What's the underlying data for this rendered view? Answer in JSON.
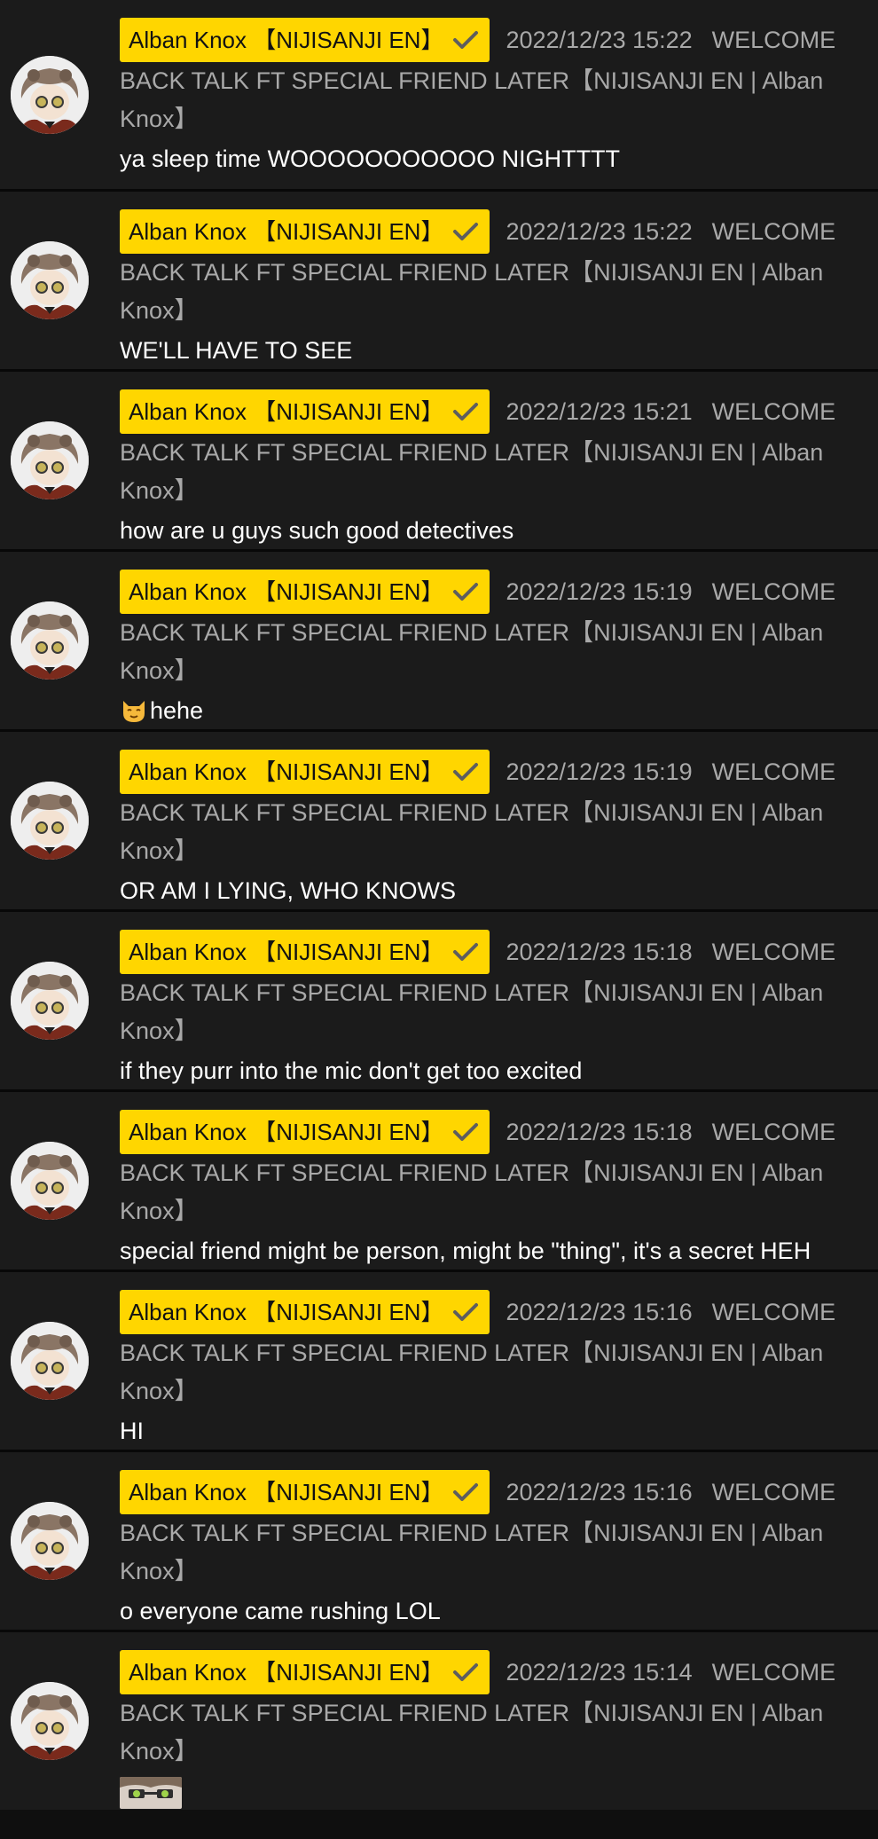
{
  "colors": {
    "badge_bg": "#ffd600",
    "row_bg": "#1b1b1b",
    "separator": "#080808",
    "meta_text": "#a9a9a9",
    "body_text": "#ffffff"
  },
  "messages": [
    {
      "author": "Alban Knox 【NIJISANJI EN】",
      "verified_icon": "checkmark-icon",
      "timestamp": "2022/12/23 15:22",
      "title_first": "WELCOME",
      "title_second": "BACK TALK FT SPECIAL FRIEND LATER【NIJISANJI EN | Alban",
      "title_third": "Knox】",
      "text": "ya sleep time WOOOOOOOOOOO NIGHTTTT"
    },
    {
      "author": "Alban Knox 【NIJISANJI EN】",
      "verified_icon": "checkmark-icon",
      "timestamp": "2022/12/23 15:22",
      "title_first": "WELCOME",
      "title_second": "BACK TALK FT SPECIAL FRIEND LATER【NIJISANJI EN | Alban",
      "title_third": "Knox】",
      "text": "WE'LL HAVE TO SEE"
    },
    {
      "author": "Alban Knox 【NIJISANJI EN】",
      "verified_icon": "checkmark-icon",
      "timestamp": "2022/12/23 15:21",
      "title_first": "WELCOME",
      "title_second": "BACK TALK FT SPECIAL FRIEND LATER【NIJISANJI EN | Alban",
      "title_third": "Knox】",
      "text": "how are u guys such good detectives"
    },
    {
      "author": "Alban Knox 【NIJISANJI EN】",
      "verified_icon": "checkmark-icon",
      "timestamp": "2022/12/23 15:19",
      "title_first": "WELCOME",
      "title_second": "BACK TALK FT SPECIAL FRIEND LATER【NIJISANJI EN | Alban",
      "title_third": "Knox】",
      "text": "hehe",
      "leading_emoji": "cat-face-emoji"
    },
    {
      "author": "Alban Knox 【NIJISANJI EN】",
      "verified_icon": "checkmark-icon",
      "timestamp": "2022/12/23 15:19",
      "title_first": "WELCOME",
      "title_second": "BACK TALK FT SPECIAL FRIEND LATER【NIJISANJI EN | Alban",
      "title_third": "Knox】",
      "text": "OR AM I LYING, WHO KNOWS"
    },
    {
      "author": "Alban Knox 【NIJISANJI EN】",
      "verified_icon": "checkmark-icon",
      "timestamp": "2022/12/23 15:18",
      "title_first": "WELCOME",
      "title_second": "BACK TALK FT SPECIAL FRIEND LATER【NIJISANJI EN | Alban",
      "title_third": "Knox】",
      "text": "if they purr into the mic don't get too excited"
    },
    {
      "author": "Alban Knox 【NIJISANJI EN】",
      "verified_icon": "checkmark-icon",
      "timestamp": "2022/12/23 15:18",
      "title_first": "WELCOME",
      "title_second": "BACK TALK FT SPECIAL FRIEND LATER【NIJISANJI EN | Alban",
      "title_third": "Knox】",
      "text": "special friend might be person, might be \"thing\", it's a secret HEH"
    },
    {
      "author": "Alban Knox 【NIJISANJI EN】",
      "verified_icon": "checkmark-icon",
      "timestamp": "2022/12/23 15:16",
      "title_first": "WELCOME",
      "title_second": "BACK TALK FT SPECIAL FRIEND LATER【NIJISANJI EN | Alban",
      "title_third": "Knox】",
      "text": "HI"
    },
    {
      "author": "Alban Knox 【NIJISANJI EN】",
      "verified_icon": "checkmark-icon",
      "timestamp": "2022/12/23 15:16",
      "title_first": "WELCOME",
      "title_second": "BACK TALK FT SPECIAL FRIEND LATER【NIJISANJI EN | Alban",
      "title_third": "Knox】",
      "text": "o everyone came rushing LOL"
    },
    {
      "author": "Alban Knox 【NIJISANJI EN】",
      "verified_icon": "checkmark-icon",
      "timestamp": "2022/12/23 15:14",
      "title_first": "WELCOME",
      "title_second": "BACK TALK FT SPECIAL FRIEND LATER【NIJISANJI EN | Alban",
      "title_third": "Knox】",
      "text": "",
      "sticker": "alban-face-sticker"
    }
  ]
}
